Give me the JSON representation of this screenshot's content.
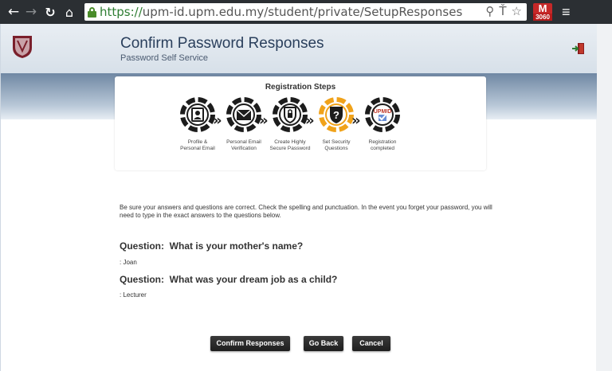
{
  "browser": {
    "url_secure": "https://",
    "url_rest": "upm-id.upm.edu.my/student/private/SetupResponses",
    "gmail_count": "3060"
  },
  "header": {
    "title": "Confirm Password Responses",
    "subtitle": "Password Self Service"
  },
  "steps": {
    "title": "Registration Steps",
    "items": [
      {
        "label_1": "Profile &",
        "label_2": "Personal Email",
        "icon": "profile-card-icon",
        "active": false
      },
      {
        "label_1": "Personal Email",
        "label_2": "Verification",
        "icon": "envelope-icon",
        "active": false
      },
      {
        "label_1": "Create Highly",
        "label_2": "Secure Password",
        "icon": "secure-password-icon",
        "active": false
      },
      {
        "label_1": "Set Security",
        "label_2": "Questions",
        "icon": "question-shield-icon",
        "active": true
      },
      {
        "label_1": "Registration",
        "label_2": "completed",
        "icon": "upmid-check-icon",
        "active": false
      }
    ],
    "upmid_text": "UPMID"
  },
  "instructions": "Be sure your answers and questions are correct. Check the spelling and punctuation. In the event you forget your password, you will need to type in the exact answers to the questions below.",
  "questions": [
    {
      "label": "Question:",
      "text": "What is your mother's name?",
      "answer": ": Joan"
    },
    {
      "label": "Question:",
      "text": "What was your dream job as a child?",
      "answer": ": Lecturer"
    }
  ],
  "buttons": {
    "confirm": "Confirm Responses",
    "go_back": "Go Back",
    "cancel": "Cancel"
  },
  "colors": {
    "active_step": "#f0a21a",
    "header_title": "#2a3f5c",
    "button_bg": "#222222"
  }
}
